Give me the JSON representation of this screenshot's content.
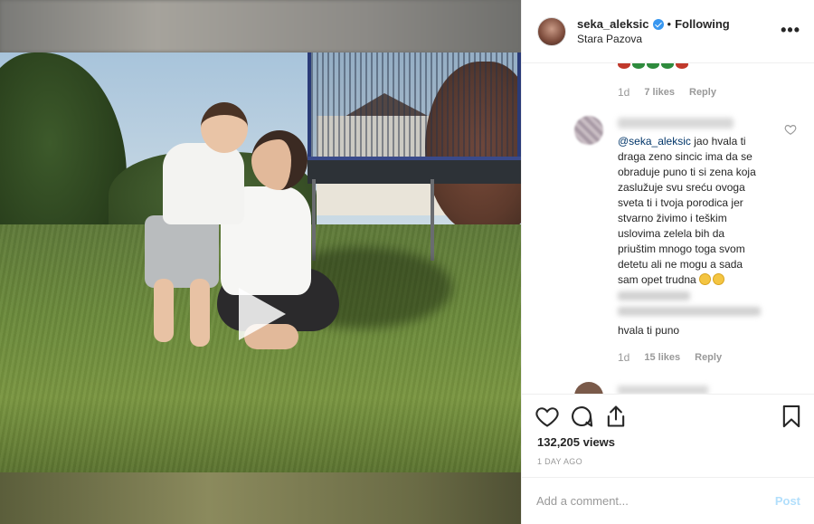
{
  "header": {
    "username": "seka_aleksic",
    "separator": "•",
    "follow_status": "Following",
    "location": "Stara Pazova",
    "more_label": "•••"
  },
  "comments": {
    "previous": {
      "time": "1d",
      "likes": "7 likes",
      "reply": "Reply"
    },
    "main": {
      "mention": "@seka_aleksic",
      "text": " jao hvala ti draga zeno sincic ima da se obraduje puno ti si zena koja zaslužuje svu sreću ovoga sveta ti i tvoja porodica jer stvarno živimo i teškim uslovima zelela bih da priuštim mnogo toga svom detetu ali ne mogu a sada sam opet trudna ",
      "second_line": "hvala ti puno",
      "time": "1d",
      "likes": "15 likes",
      "reply": "Reply"
    }
  },
  "stats": {
    "views": "132,205 views",
    "posted": "1 DAY AGO"
  },
  "composer": {
    "placeholder": "Add a comment...",
    "post_label": "Post"
  },
  "icons": {
    "heart": "heart-icon",
    "comment": "comment-icon",
    "share": "share-icon",
    "save": "bookmark-icon",
    "play": "play-icon",
    "verified": "verified-badge-icon"
  },
  "colors": {
    "link": "#003569",
    "verified": "#3897f0",
    "post_disabled": "#b2dffc",
    "muted": "#999999"
  }
}
